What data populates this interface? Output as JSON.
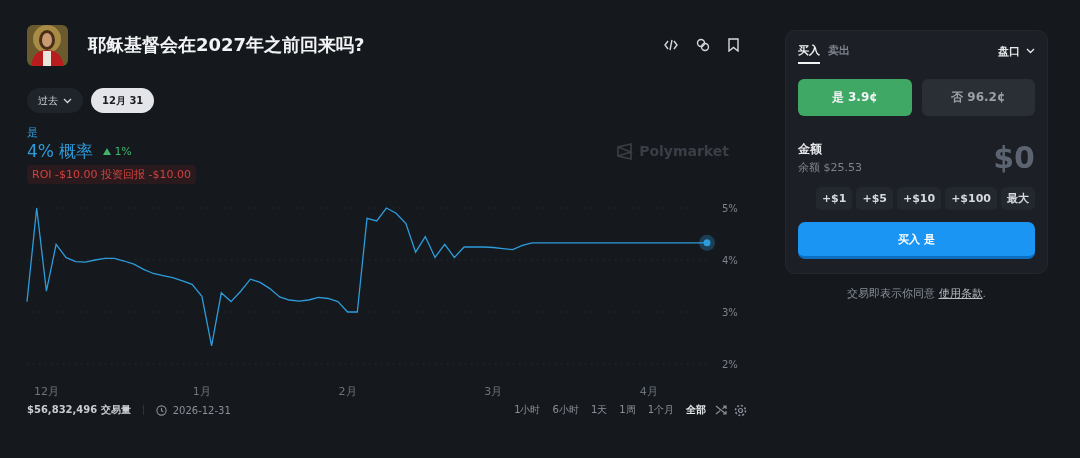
{
  "market": {
    "title": "耶稣基督会在2027年之前回来吗?"
  },
  "filters": [
    {
      "label": "过去",
      "kind": "dropdown",
      "selected": false
    },
    {
      "label": "12月 31",
      "kind": "chip",
      "selected": true
    }
  ],
  "outcome": {
    "probability": "4% 概率",
    "change": "1%",
    "roi": "ROI -$10.00  投资回报 -$10.00"
  },
  "brand": "Polymarket",
  "chart_data": {
    "type": "line",
    "grid": true,
    "ylim": [
      2,
      5
    ],
    "categories": [
      null,
      null,
      "12月",
      null,
      null,
      null,
      null,
      null,
      null,
      null,
      null,
      null,
      null,
      null,
      null,
      null,
      null,
      null,
      "1月",
      null,
      null,
      null,
      null,
      null,
      null,
      null,
      null,
      null,
      null,
      null,
      null,
      null,
      null,
      "2月",
      null,
      null,
      null,
      null,
      null,
      null,
      null,
      null,
      null,
      null,
      null,
      null,
      null,
      null,
      "3月",
      null,
      null,
      null,
      null,
      null,
      null,
      null,
      null,
      null,
      null,
      null,
      null,
      null,
      null,
      null,
      "4月",
      null,
      null,
      null,
      null,
      null,
      null
    ],
    "yticks": [
      {
        "value": 2,
        "label": "2%"
      },
      {
        "value": 3,
        "label": "3%"
      },
      {
        "value": 4,
        "label": "4%"
      },
      {
        "value": 5,
        "label": "5%"
      }
    ],
    "series": [
      {
        "name": "是",
        "color": "#2d9cdb",
        "values": [
          3.2,
          5.0,
          3.4,
          4.3,
          4.05,
          3.97,
          3.96,
          4.0,
          4.03,
          4.03,
          3.98,
          3.92,
          3.82,
          3.74,
          3.7,
          3.66,
          3.6,
          3.53,
          3.3,
          2.35,
          3.37,
          3.2,
          3.4,
          3.63,
          3.57,
          3.45,
          3.29,
          3.23,
          3.21,
          3.23,
          3.28,
          3.26,
          3.2,
          3.0,
          3.0,
          4.8,
          4.75,
          5.0,
          4.9,
          4.7,
          4.15,
          4.45,
          4.05,
          4.3,
          4.05,
          4.25,
          4.25,
          4.25,
          4.24,
          4.22,
          4.2,
          4.28,
          4.33,
          4.33,
          4.33,
          4.33,
          4.33,
          4.33,
          4.33,
          4.33,
          4.33,
          4.33,
          4.33,
          4.33,
          4.33,
          4.33,
          4.33,
          4.33,
          4.33,
          4.33,
          4.33
        ]
      }
    ]
  },
  "footer": {
    "volume": "$56,832,496 交易量",
    "date": "2026-12-31",
    "ranges": [
      {
        "label": "1小时",
        "selected": false
      },
      {
        "label": "6小时",
        "selected": false
      },
      {
        "label": "1天",
        "selected": false
      },
      {
        "label": "1周",
        "selected": false
      },
      {
        "label": "1个月",
        "selected": false
      },
      {
        "label": "全部",
        "selected": true
      }
    ]
  },
  "trade": {
    "tabs": [
      {
        "label": "买入",
        "selected": true
      },
      {
        "label": "卖出",
        "selected": false
      }
    ],
    "order_type": "盘口",
    "outcomes": [
      {
        "label": "是 3.9¢",
        "selected": true
      },
      {
        "label": "否 96.2¢",
        "selected": false
      }
    ],
    "amount_label": "金额",
    "balance": "余额 $25.53",
    "amount": "$0",
    "quick_adds": [
      "+$1",
      "+$5",
      "+$10",
      "+$100",
      "最大"
    ],
    "submit": "买入 是"
  },
  "terms": {
    "text": "交易即表示你同意",
    "link": "使用条款",
    "suffix": "."
  }
}
